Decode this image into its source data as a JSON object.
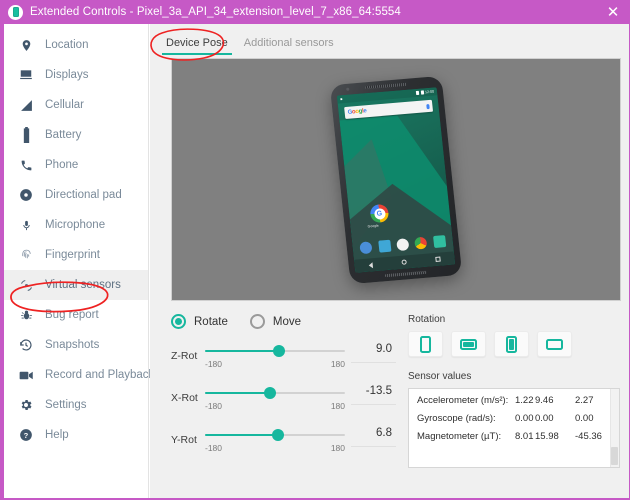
{
  "window": {
    "title": "Extended Controls - Pixel_3a_API_34_extension_level_7_x86_64:5554",
    "close_label": "✕",
    "titlebar_color": "#c659c6",
    "accent_color": "#16b79e"
  },
  "sidebar": {
    "items": [
      {
        "label": "Location",
        "icon": "location-pin-icon",
        "selected": false
      },
      {
        "label": "Displays",
        "icon": "monitor-icon",
        "selected": false
      },
      {
        "label": "Cellular",
        "icon": "signal-bars-icon",
        "selected": false
      },
      {
        "label": "Battery",
        "icon": "battery-icon",
        "selected": false
      },
      {
        "label": "Phone",
        "icon": "phone-handset-icon",
        "selected": false
      },
      {
        "label": "Directional pad",
        "icon": "dpad-icon",
        "selected": false
      },
      {
        "label": "Microphone",
        "icon": "microphone-icon",
        "selected": false
      },
      {
        "label": "Fingerprint",
        "icon": "fingerprint-icon",
        "selected": false
      },
      {
        "label": "Virtual sensors",
        "icon": "virtual-sensors-icon",
        "selected": true
      },
      {
        "label": "Bug report",
        "icon": "bug-icon",
        "selected": false
      },
      {
        "label": "Snapshots",
        "icon": "history-clock-icon",
        "selected": false
      },
      {
        "label": "Record and Playback",
        "icon": "video-camera-icon",
        "selected": false
      },
      {
        "label": "Settings",
        "icon": "gear-icon",
        "selected": false
      },
      {
        "label": "Help",
        "icon": "question-mark-icon",
        "selected": false
      }
    ]
  },
  "tabs": [
    {
      "label": "Device Pose",
      "active": true
    },
    {
      "label": "Additional sensors",
      "active": false
    }
  ],
  "preview": {
    "background_color": "#808080",
    "phone_search_text": "Google",
    "phone_status_time": "12:00",
    "phone_g_label": "Google"
  },
  "pose_controls": {
    "modes": [
      {
        "label": "Rotate",
        "checked": true
      },
      {
        "label": "Move",
        "checked": false
      }
    ],
    "sliders": [
      {
        "name": "Z-Rot",
        "value": "9.0",
        "min": "-180",
        "max": "180",
        "percent": 52.5
      },
      {
        "name": "X-Rot",
        "value": "-13.5",
        "min": "-180",
        "max": "180",
        "percent": 46.3
      },
      {
        "name": "Y-Rot",
        "value": "6.8",
        "min": "-180",
        "max": "180",
        "percent": 51.9
      }
    ]
  },
  "rotation": {
    "title": "Rotation",
    "buttons": [
      {
        "name": "portrait",
        "orientation": "portrait",
        "filled": false
      },
      {
        "name": "landscape",
        "orientation": "landscape",
        "filled": true
      },
      {
        "name": "reverse-portrait",
        "orientation": "portrait",
        "filled": true
      },
      {
        "name": "reverse-landscape",
        "orientation": "landscape",
        "filled": false
      }
    ]
  },
  "sensor_values": {
    "title": "Sensor values",
    "rows": [
      {
        "label": "Accelerometer (m/s²):",
        "x": "1.22",
        "y": "9.46",
        "z": "2.27"
      },
      {
        "label": "Gyroscope (rad/s):",
        "x": "0.00",
        "y": "0.00",
        "z": "0.00"
      },
      {
        "label": "Magnetometer (µT):",
        "x": "8.01",
        "y": "15.98",
        "z": "-45.36"
      }
    ]
  },
  "annotations": {
    "color": "#ee2222",
    "marks": [
      {
        "name": "device-pose-tab-circle"
      },
      {
        "name": "virtual-sensors-circle"
      }
    ]
  }
}
